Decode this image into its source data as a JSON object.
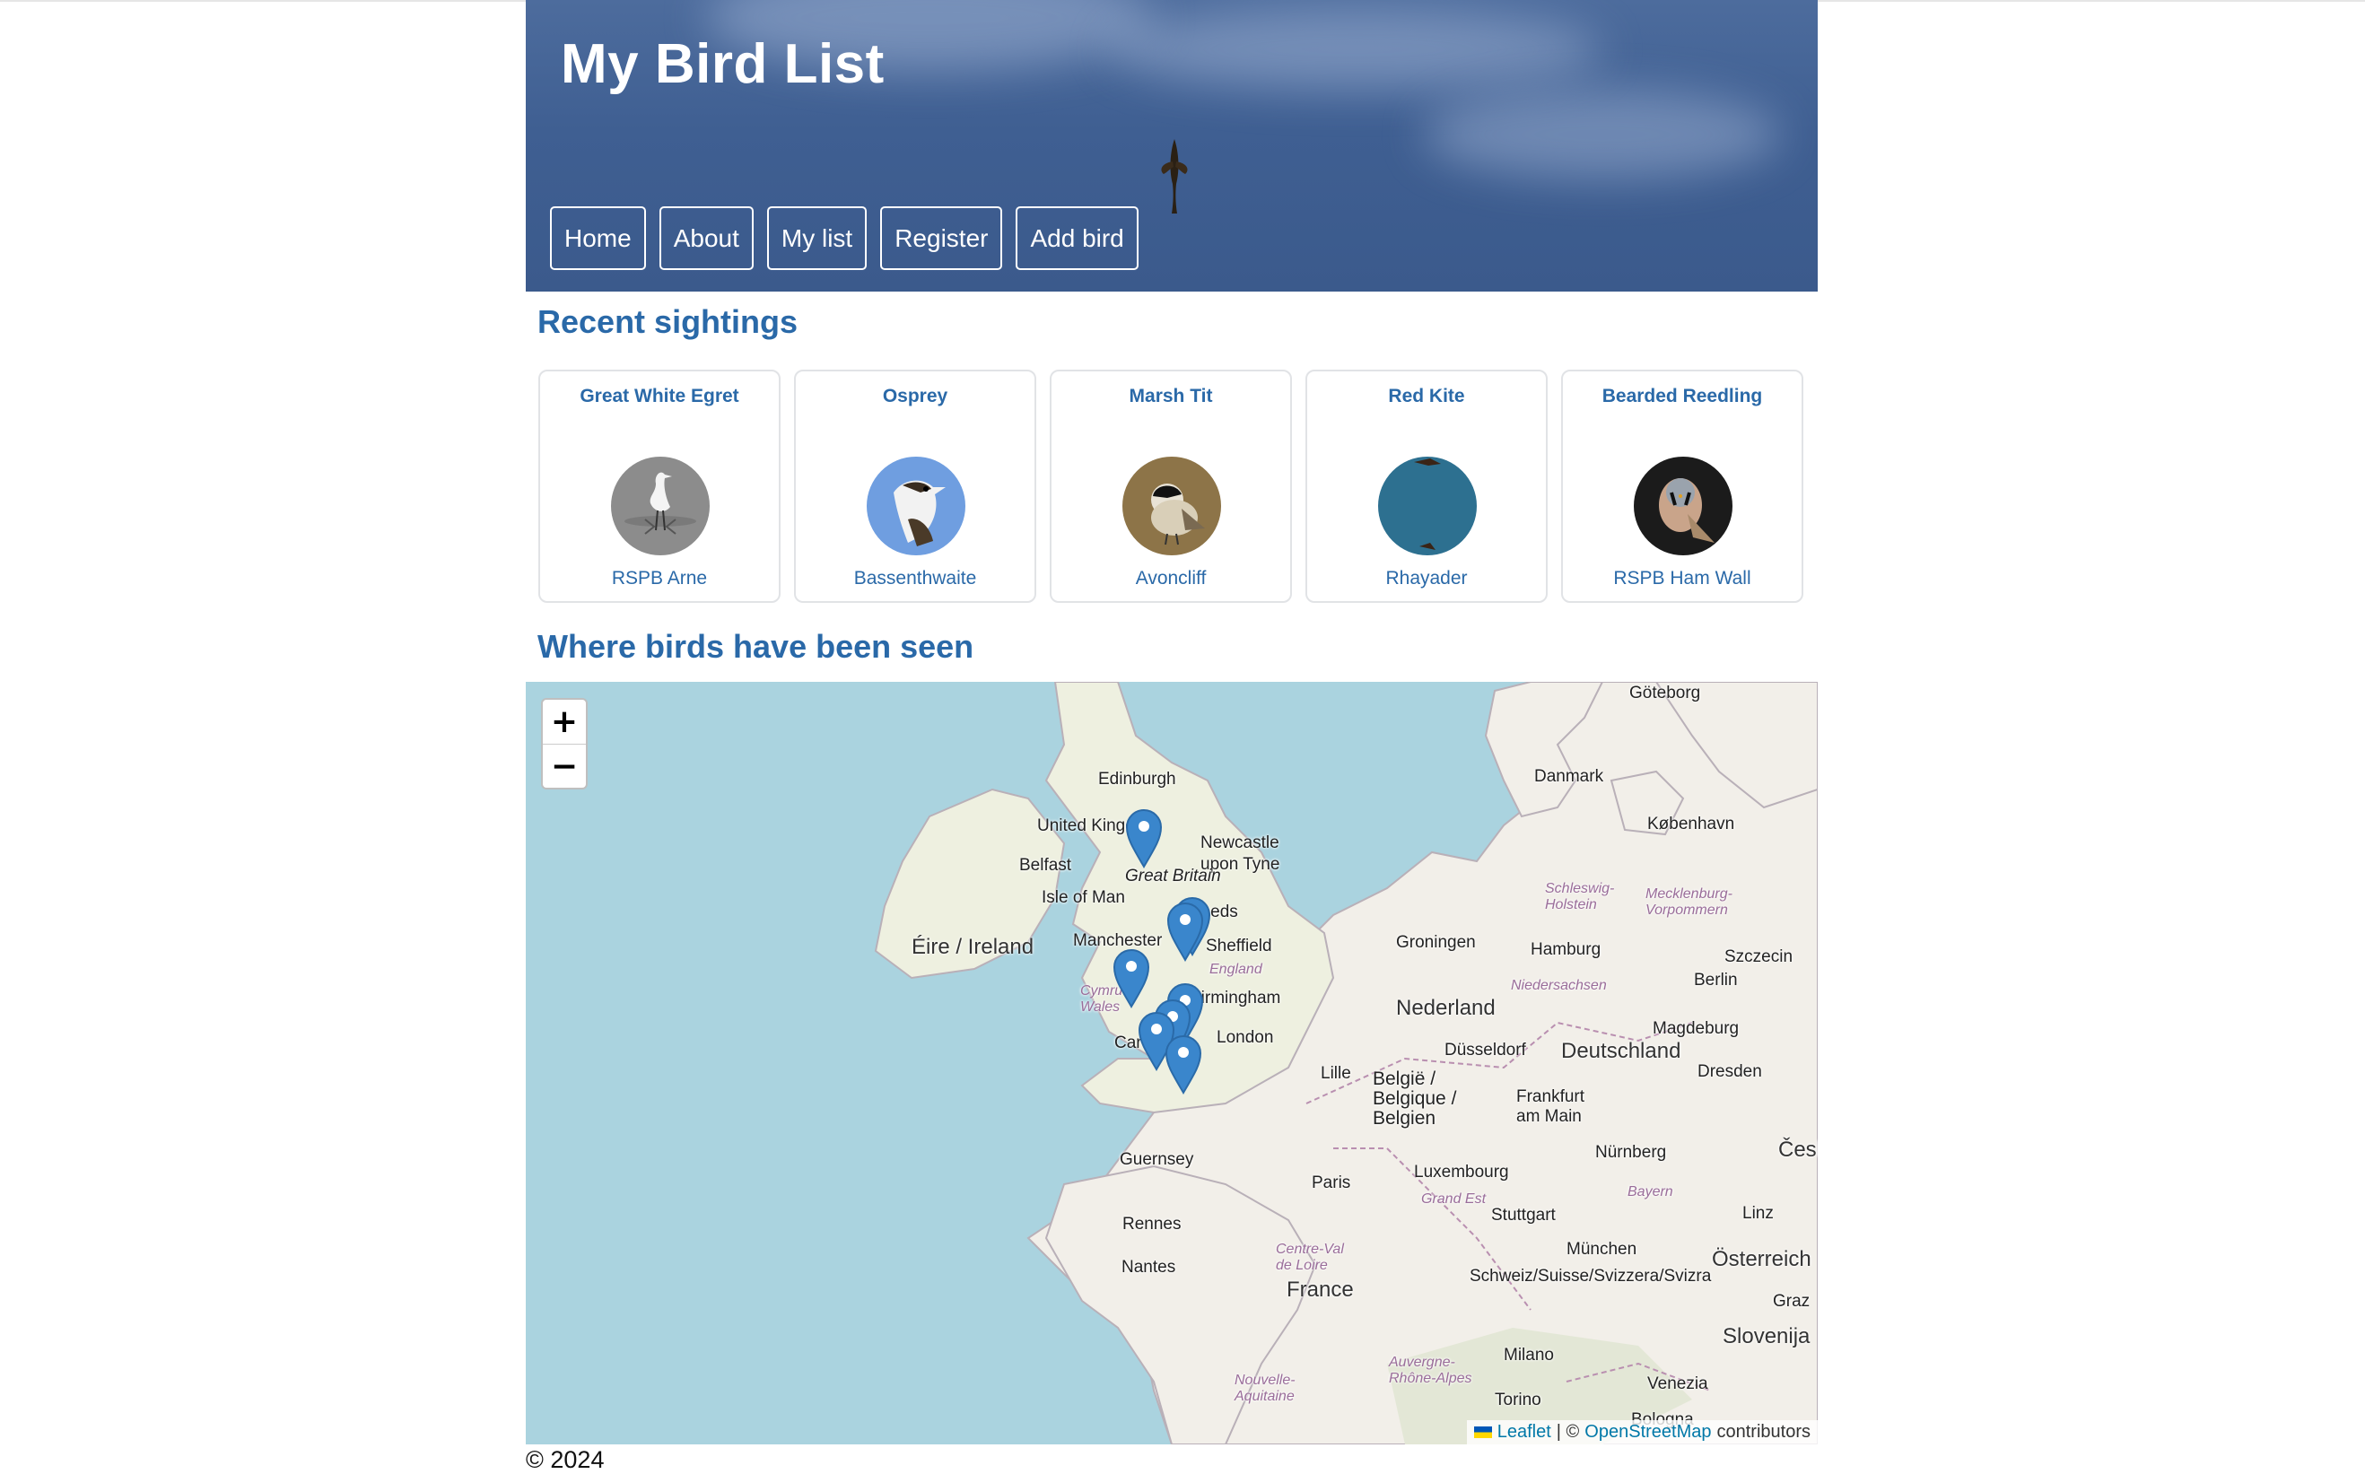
{
  "header": {
    "title": "My Bird List",
    "nav": [
      "Home",
      "About",
      "My list",
      "Register",
      "Add bird"
    ]
  },
  "recent": {
    "heading": "Recent sightings",
    "cards": [
      {
        "name": "Great White Egret",
        "location": "RSPB Arne"
      },
      {
        "name": "Osprey",
        "location": "Bassenthwaite"
      },
      {
        "name": "Marsh Tit",
        "location": "Avoncliff"
      },
      {
        "name": "Red Kite",
        "location": "Rhayader"
      },
      {
        "name": "Bearded Reedling",
        "location": "RSPB Ham Wall"
      }
    ]
  },
  "map": {
    "heading": "Where birds have been seen",
    "zoom_in": "+",
    "zoom_out": "−",
    "attribution": {
      "leaflet": "Leaflet",
      "sep": "| ©",
      "osm": "OpenStreetMap",
      "contributors": "contributors"
    },
    "places": [
      "Göteborg",
      "Edinburgh",
      "United Kingdom",
      "Danmark",
      "København",
      "Belfast",
      "Newcastle upon Tyne",
      "Great Britain",
      "Isle of Man",
      "Leeds",
      "Éire / Ireland",
      "Manchester",
      "Sheffield",
      "Cymru / Wales",
      "England",
      "Birmingham",
      "Groningen",
      "Hamburg",
      "Szczecin",
      "Schleswig-Holstein",
      "Mecklenburg-Vorpommern",
      "Niedersachsen",
      "Berlin",
      "Nederland",
      "Magdeburg",
      "Cardiff",
      "London",
      "Düsseldorf",
      "Deutschland",
      "Dresden",
      "Lille",
      "België / Belgique / Belgien",
      "Frankfurt am Main",
      "Luxembourg",
      "Nürnberg",
      "Česko",
      "Guernsey",
      "Paris",
      "Grand Est",
      "Bayern",
      "Rennes",
      "Stuttgart",
      "Linz",
      "Centre-Val de Loire",
      "München",
      "Österreich",
      "Nantes",
      "France",
      "Schweiz/Suisse/Svizzera/Svizra",
      "Graz",
      "Slovenija",
      "Milano",
      "Nouvelle-Aquitaine",
      "Auvergne-Rhône-Alpes",
      "Torino",
      "Venezia",
      "Bologna"
    ]
  },
  "footer": {
    "text": "© 2024"
  },
  "colors": {
    "accent": "#2a69a8",
    "header_bg": "#3f5f92",
    "sea": "#aad3df",
    "land": "#f2efe9",
    "marker": "#3a86cc"
  }
}
